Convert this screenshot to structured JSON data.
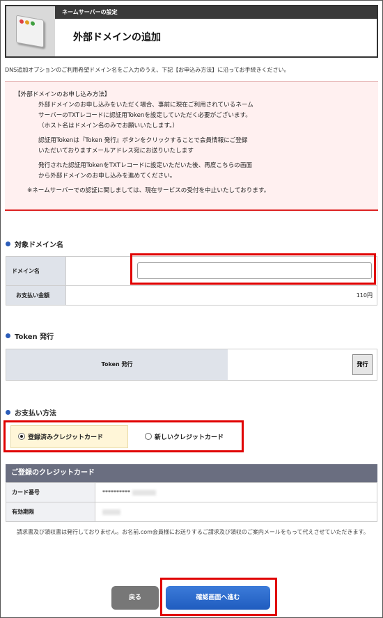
{
  "header": {
    "category": "ネームサーバーの設定",
    "title": "外部ドメインの追加"
  },
  "intro": "DNS追加オプションのご利用希望ドメイン名をご入力のうえ、下記【お申込み方法】に沿ってお手続きください。",
  "notice": {
    "heading": "【外部ドメインのお申し込み方法】",
    "p1_l1": "外部ドメインのお申し込みをいただく場合、事前に現在ご利用されているネーム",
    "p1_l2": "サーバーのTXTレコードに認証用Tokenを設定していただく必要がございます。",
    "p1_l3": "（ホスト名はドメイン名のみでお願いいたします。）",
    "p2_l1": "認証用Tokenは『Token 発行』ボタンをクリックすることで会員情報にご登録",
    "p2_l2": "いただいておりますメールアドレス宛にお送りいたします",
    "p3_l1": "発行された認証用TokenをTXTレコードに設定いただいた後、再度こちらの画面",
    "p3_l2": "から外部ドメインのお申し込みを進めてください。",
    "p4": "※ネームサーバーでの認証に関しましては、現在サービスの受付を中止いたしております。"
  },
  "domain_section": {
    "title": "対象ドメイン名",
    "domain_label": "ドメイン名",
    "domain_value": "",
    "payment_label": "お支払い金額",
    "payment_value": "110円"
  },
  "token_section": {
    "title": "Token 発行",
    "label": "Token 発行",
    "button": "発行"
  },
  "payment_section": {
    "title": "お支払い方法",
    "option_registered": "登録済みクレジットカード",
    "option_new": "新しいクレジットカード"
  },
  "card_section": {
    "title": "ご登録のクレジットカード",
    "number_label": "カード番号",
    "number_value": "**********",
    "expiry_label": "有効期限"
  },
  "footnote": "請求書及び領収書は発行しておりません。お名前.com会員様にお送りするご請求及び領収のご案内メールをもって代えさせていただきます。",
  "buttons": {
    "back": "戻る",
    "next": "確認画面へ進む"
  },
  "colors": {
    "accent_red": "#e00000",
    "primary_blue": "#1f5cbf",
    "header_dark": "#3a3a3a"
  }
}
